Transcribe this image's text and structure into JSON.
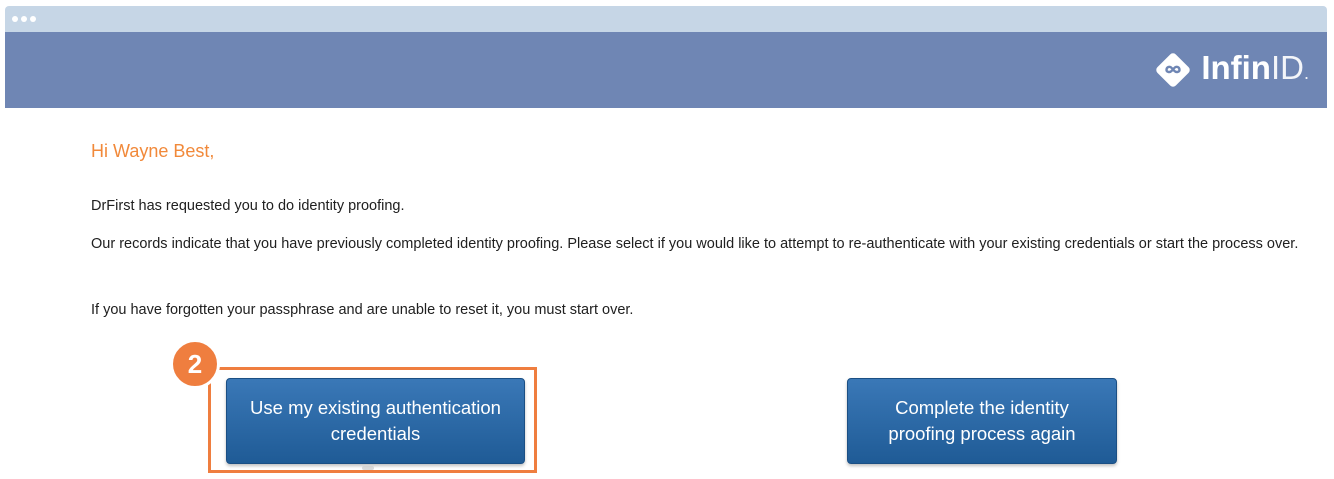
{
  "window": {
    "dots_icon": "window-dots-icon"
  },
  "header": {
    "logo_icon": "infinity-diamond-icon",
    "logo_text_bold": "Infin",
    "logo_text_thin": "ID",
    "logo_mark": "."
  },
  "main": {
    "greeting": "Hi Wayne Best,",
    "paragraph_request": "DrFirst has requested you to do identity proofing.",
    "paragraph_records": "Our records indicate that you have previously completed identity proofing. Please select if you would like to attempt to re-authenticate with your existing credentials or start the process over.",
    "paragraph_forgot": "If you have forgotten your passphrase and are unable to reset it, you must start over."
  },
  "actions": {
    "step_number": "2",
    "use_existing_label": "Use my existing authentication credentials",
    "restart_label": "Complete the identity proofing process again"
  },
  "colors": {
    "header_bg": "#6f86b4",
    "browser_bar": "#c6d6e6",
    "accent_orange": "#ef7e3f",
    "greeting_orange": "#f1893a",
    "button_blue": "#2a6aa8"
  }
}
